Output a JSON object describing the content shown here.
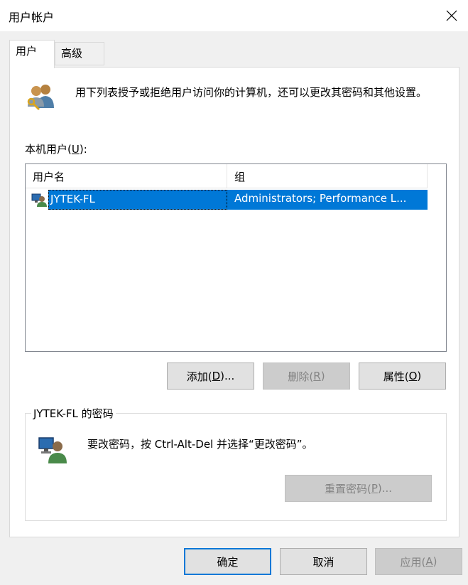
{
  "window": {
    "title": "用户帐户"
  },
  "tabs": [
    {
      "label": "用户"
    },
    {
      "label": "高级"
    }
  ],
  "intro": {
    "text": "用下列表授予或拒绝用户访问你的计算机，还可以更改其密码和其他设置。"
  },
  "local_users": {
    "label": "本机用户(",
    "label_hotkey": "U",
    "label_end": "):",
    "columns": [
      "用户名",
      "组"
    ],
    "rows": [
      {
        "name": "JYTEK-FL",
        "group": "Administrators; Performance L..."
      }
    ],
    "icons": {
      "users": "users-key-icon",
      "row_user": "user-computer-icon"
    }
  },
  "buttons": {
    "add": {
      "prefix": "添加(",
      "hotkey": "D",
      "suffix": ")..."
    },
    "remove": {
      "prefix": "删除(",
      "hotkey": "R",
      "suffix": ")"
    },
    "properties": {
      "prefix": "属性(",
      "hotkey": "O",
      "suffix": ")"
    },
    "reset_password": {
      "prefix": "重置密码(",
      "hotkey": "P",
      "suffix": ")..."
    },
    "ok": "确定",
    "cancel": "取消",
    "apply": {
      "prefix": "应用(",
      "hotkey": "A",
      "suffix": ")"
    }
  },
  "password_group": {
    "title": "JYTEK-FL 的密码",
    "text": "要改密码，按 Ctrl-Alt-Del 并选择“更改密码”。",
    "icon": "user-password-icon"
  },
  "colors": {
    "selection": "#0078d7",
    "default_button_border": "#0078d7"
  }
}
